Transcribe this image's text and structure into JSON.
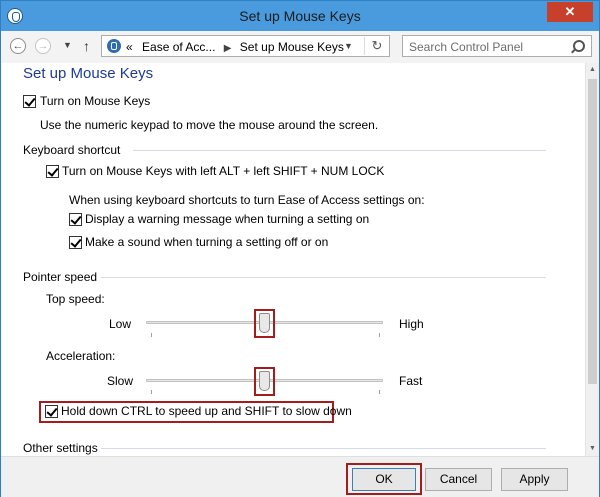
{
  "window": {
    "title": "Set up Mouse Keys",
    "close_glyph": "✕"
  },
  "nav": {
    "back_glyph": "←",
    "forward_glyph": "→",
    "recent_glyph": "▼",
    "up_glyph": "↑",
    "address_crumbs": [
      "Ease of Acc...",
      "Set up Mouse Keys"
    ],
    "address_prefix": "«",
    "crumb_sep": "▶",
    "dropdown_glyph": "▼",
    "refresh_glyph": "↻",
    "search_placeholder": "Search Control Panel"
  },
  "page": {
    "title": "Set up Mouse Keys",
    "turn_on": {
      "label": "Turn on Mouse Keys",
      "checked": true
    },
    "turn_on_desc": "Use the numeric keypad to move the mouse around the screen.",
    "keyboard_shortcut": {
      "title": "Keyboard shortcut",
      "shortcut": {
        "label": "Turn on Mouse Keys with left ALT + left SHIFT + NUM LOCK",
        "checked": true
      },
      "sub_caption": "When using keyboard shortcuts to turn Ease of Access settings on:",
      "warning": {
        "label": "Display a warning message when turning a setting on",
        "checked": true
      },
      "sound": {
        "label": "Make a sound when turning a setting off or on",
        "checked": true
      }
    },
    "pointer_speed": {
      "title": "Pointer speed",
      "top_speed": {
        "label": "Top speed:",
        "min_label": "Low",
        "max_label": "High",
        "value": 0.5
      },
      "acceleration": {
        "label": "Acceleration:",
        "min_label": "Slow",
        "max_label": "Fast",
        "value": 0.5
      },
      "ctrl_shift": {
        "label": "Hold down CTRL to speed up and SHIFT to slow down",
        "checked": true
      }
    },
    "other_settings": {
      "title": "Other settings"
    }
  },
  "footer": {
    "ok": "OK",
    "cancel": "Cancel",
    "apply": "Apply"
  },
  "colors": {
    "title_bar": "#4a9bdd",
    "page_title": "#1e3b91",
    "highlight": "#a51c1c",
    "close": "#c7402c"
  }
}
